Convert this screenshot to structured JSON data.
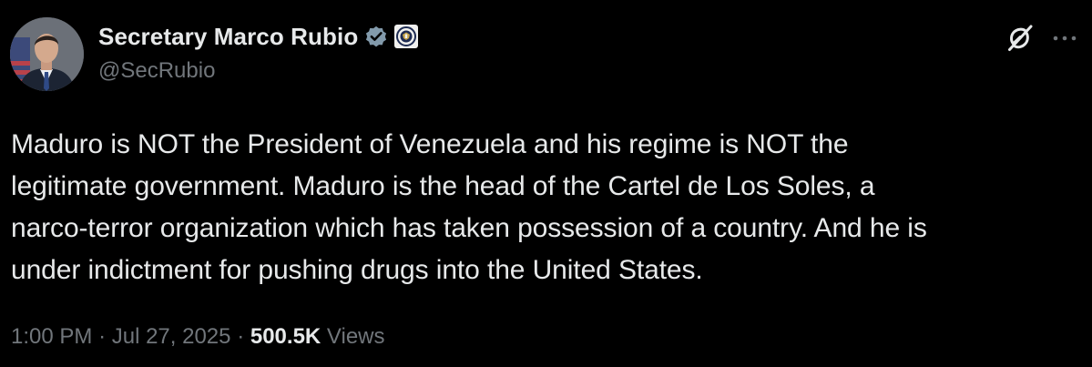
{
  "author": {
    "display_name": "Secretary Marco Rubio",
    "handle": "@SecRubio",
    "avatar_icon": "profile-photo",
    "verified_icon": "verified-badge-icon",
    "affiliation_icon": "state-department-seal-icon"
  },
  "post": {
    "text": "Maduro is NOT the President of Venezuela and his regime is NOT the\nlegitimate government.  Maduro is the head of the Cartel de Los Soles, a\nnarco-terror organization which has taken possession of a country.  And he is\nunder indictment for pushing drugs into the United States."
  },
  "meta": {
    "time": "1:00 PM",
    "separator": "·",
    "date": "Jul 27, 2025",
    "views_count": "500.5K",
    "views_label": "Views"
  },
  "actions": {
    "grok_icon": "grok-icon",
    "more_icon": "more-icon"
  },
  "colors": {
    "background": "#000000",
    "primary_text": "#e7e9ea",
    "secondary_text": "#71767b",
    "verified_badge": "#829aab"
  }
}
